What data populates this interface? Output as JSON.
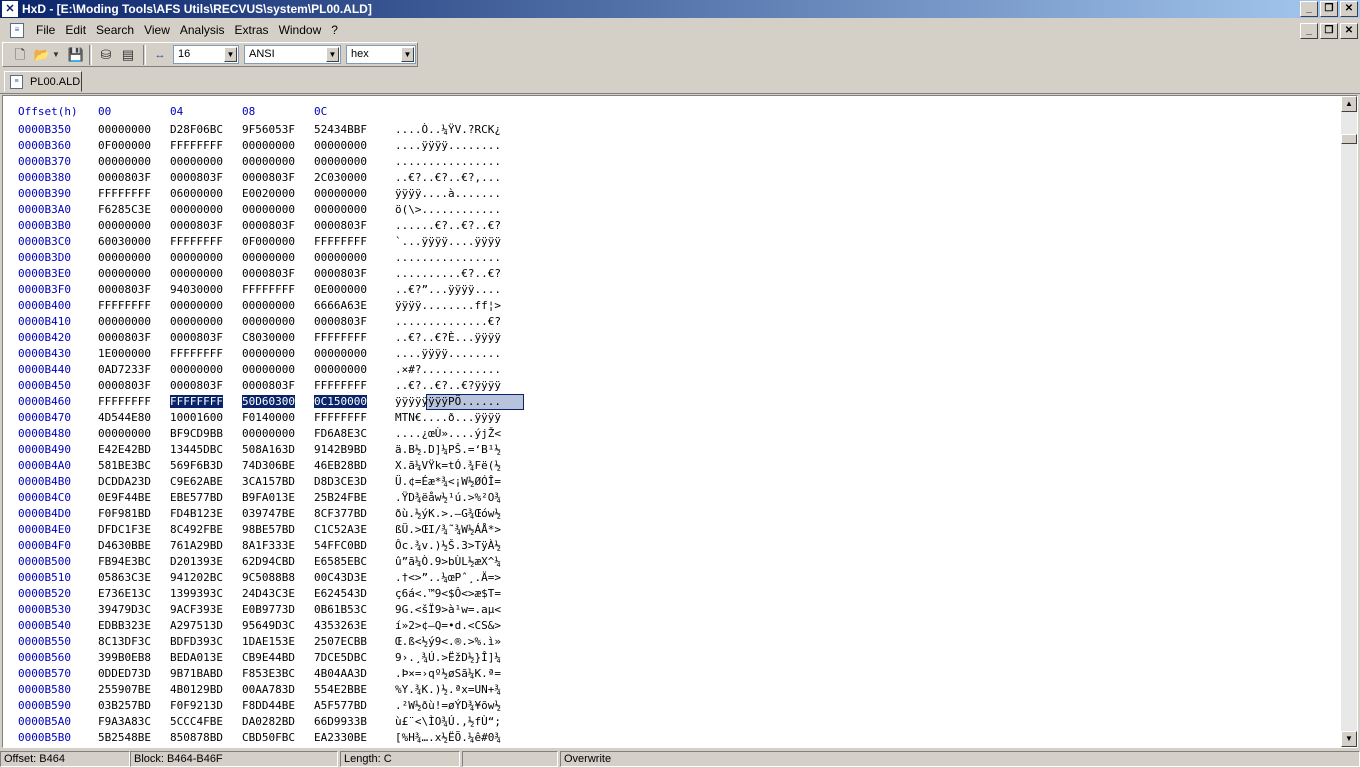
{
  "window": {
    "title": "HxD - [E:\\Moding Tools\\AFS Utils\\RECVUS\\system\\PL00.ALD]",
    "app_icon": "hxd-logo-icon"
  },
  "menu": [
    "File",
    "Edit",
    "Search",
    "View",
    "Analysis",
    "Extras",
    "Window",
    "?"
  ],
  "toolbar": {
    "bytes_per_row": "16",
    "charset": "ANSI",
    "offset_base": "hex"
  },
  "tab": {
    "label": "PL00.ALD"
  },
  "editor": {
    "header": {
      "offset": "Offset(h)",
      "cols": [
        "00",
        "04",
        "08",
        "0C"
      ]
    },
    "rows": [
      {
        "o": "0000B350",
        "g": [
          "00000000",
          "D28F06BC",
          "9F56053F",
          "52434BBF"
        ],
        "a": "....Ò..¼ŸV.?RCK¿"
      },
      {
        "o": "0000B360",
        "g": [
          "0F000000",
          "FFFFFFFF",
          "00000000",
          "00000000"
        ],
        "a": "....ÿÿÿÿ........"
      },
      {
        "o": "0000B370",
        "g": [
          "00000000",
          "00000000",
          "00000000",
          "00000000"
        ],
        "a": "................"
      },
      {
        "o": "0000B380",
        "g": [
          "0000803F",
          "0000803F",
          "0000803F",
          "2C030000"
        ],
        "a": "..€?..€?..€?,..."
      },
      {
        "o": "0000B390",
        "g": [
          "FFFFFFFF",
          "06000000",
          "E0020000",
          "00000000"
        ],
        "a": "ÿÿÿÿ....à......."
      },
      {
        "o": "0000B3A0",
        "g": [
          "F6285C3E",
          "00000000",
          "00000000",
          "00000000"
        ],
        "a": "ö(\\>............"
      },
      {
        "o": "0000B3B0",
        "g": [
          "00000000",
          "0000803F",
          "0000803F",
          "0000803F"
        ],
        "a": "......€?..€?..€?"
      },
      {
        "o": "0000B3C0",
        "g": [
          "60030000",
          "FFFFFFFF",
          "0F000000",
          "FFFFFFFF"
        ],
        "a": "`...ÿÿÿÿ....ÿÿÿÿ"
      },
      {
        "o": "0000B3D0",
        "g": [
          "00000000",
          "00000000",
          "00000000",
          "00000000"
        ],
        "a": "................"
      },
      {
        "o": "0000B3E0",
        "g": [
          "00000000",
          "00000000",
          "0000803F",
          "0000803F"
        ],
        "a": "..........€?..€?"
      },
      {
        "o": "0000B3F0",
        "g": [
          "0000803F",
          "94030000",
          "FFFFFFFF",
          "0E000000"
        ],
        "a": "..€?”...ÿÿÿÿ...."
      },
      {
        "o": "0000B400",
        "g": [
          "FFFFFFFF",
          "00000000",
          "00000000",
          "6666A63E"
        ],
        "a": "ÿÿÿÿ........ff¦>"
      },
      {
        "o": "0000B410",
        "g": [
          "00000000",
          "00000000",
          "00000000",
          "0000803F"
        ],
        "a": "..............€?"
      },
      {
        "o": "0000B420",
        "g": [
          "0000803F",
          "0000803F",
          "C8030000",
          "FFFFFFFF"
        ],
        "a": "..€?..€?È...ÿÿÿÿ"
      },
      {
        "o": "0000B430",
        "g": [
          "1E000000",
          "FFFFFFFF",
          "00000000",
          "00000000"
        ],
        "a": "....ÿÿÿÿ........"
      },
      {
        "o": "0000B440",
        "g": [
          "0AD7233F",
          "00000000",
          "00000000",
          "00000000"
        ],
        "a": ".×#?............"
      },
      {
        "o": "0000B450",
        "g": [
          "0000803F",
          "0000803F",
          "0000803F",
          "FFFFFFFF"
        ],
        "a": "..€?..€?..€?ÿÿÿÿ"
      },
      {
        "o": "0000B460",
        "g": [
          "FFFFFFFF",
          "FFFFFFFF",
          "50D60300",
          "0C150000"
        ],
        "a": "ÿÿÿÿÿÿÿÿPÖ......"
      },
      {
        "o": "0000B470",
        "g": [
          "4D544E80",
          "10001600",
          "F0140000",
          "FFFFFFFF"
        ],
        "a": "MTN€....ð...ÿÿÿÿ"
      },
      {
        "o": "0000B480",
        "g": [
          "00000000",
          "BF9CD9BB",
          "00000000",
          "FD6A8E3C"
        ],
        "a": "....¿œÙ»....ýjŽ<"
      },
      {
        "o": "0000B490",
        "g": [
          "E42E42BD",
          "13445DBC",
          "508A163D",
          "9142B9BD"
        ],
        "a": "ä.B½.D]¼PŠ.=‘B¹½"
      },
      {
        "o": "0000B4A0",
        "g": [
          "581BE3BC",
          "569F6B3D",
          "74D306BE",
          "46EB28BD"
        ],
        "a": "X.ã¼VŸk=tÓ.¾Fë(½"
      },
      {
        "o": "0000B4B0",
        "g": [
          "DCDDA23D",
          "C9E62ABE",
          "3CA157BD",
          "D8D3CE3D"
        ],
        "a": "Ü.¢=Éæ*¾<¡W½ØÓÎ="
      },
      {
        "o": "0000B4C0",
        "g": [
          "0E9F44BE",
          "EBE577BD",
          "B9FA013E",
          "25B24FBE"
        ],
        "a": ".ŸD¾ëåw½¹ú.>%²O¾"
      },
      {
        "o": "0000B4D0",
        "g": [
          "F0F981BD",
          "FD4B123E",
          "039747BE",
          "8CF377BD"
        ],
        "a": "ðù.½ýK.>.—G¾Œów½"
      },
      {
        "o": "0000B4E0",
        "g": [
          "DFDC1F3E",
          "8C492FBE",
          "98BE57BD",
          "C1C52A3E"
        ],
        "a": "ßÜ.>ŒI/¾˜¾W½ÁÅ*>"
      },
      {
        "o": "0000B4F0",
        "g": [
          "D4630BBE",
          "761A29BD",
          "8A1F333E",
          "54FFC0BD"
        ],
        "a": "Ôc.¾v.)½Š.3>TÿÀ½"
      },
      {
        "o": "0000B500",
        "g": [
          "FB94E3BC",
          "D201393E",
          "62D94CBD",
          "E6585EBC"
        ],
        "a": "û”ã¼Ò.9>bÙL½æX^¼"
      },
      {
        "o": "0000B510",
        "g": [
          "05863C3E",
          "941202BC",
          "9C5088B8",
          "00C43D3E"
        ],
        "a": ".†<>”..¼œPˆ¸.Ä=>"
      },
      {
        "o": "0000B520",
        "g": [
          "E736E13C",
          "1399393C",
          "24D43C3E",
          "E624543D"
        ],
        "a": "ç6á<.™9<$Ô<>æ$T="
      },
      {
        "o": "0000B530",
        "g": [
          "39479D3C",
          "9ACF393E",
          "E0B9773D",
          "0B61B53C"
        ],
        "a": "9G.<šÏ9>à¹w=.aµ<"
      },
      {
        "o": "0000B540",
        "g": [
          "EDBB323E",
          "A297513D",
          "95649D3C",
          "4353263E"
        ],
        "a": "í»2>¢—Q=•d.<CS&>"
      },
      {
        "o": "0000B550",
        "g": [
          "8C13DF3C",
          "BDFD393C",
          "1DAE153E",
          "2507ECBB"
        ],
        "a": "Œ.ß<½ý9<.®.>%.ì»"
      },
      {
        "o": "0000B560",
        "g": [
          "399B0EB8",
          "BEDA013E",
          "CB9E44BD",
          "7DCE5DBC"
        ],
        "a": "9›.¸¾Ú.>ËžD½}Î]¼"
      },
      {
        "o": "0000B570",
        "g": [
          "0DDED73D",
          "9B71BABD",
          "F853E3BC",
          "4B04AA3D"
        ],
        "a": ".Þ×=›qº½øSã¼K.ª="
      },
      {
        "o": "0000B580",
        "g": [
          "255907BE",
          "4B0129BD",
          "00AA783D",
          "554E2BBE"
        ],
        "a": "%Y.¾K.)½.ªx=UN+¾"
      },
      {
        "o": "0000B590",
        "g": [
          "03B257BD",
          "F0F9213D",
          "F8DD44BE",
          "A5F577BD"
        ],
        "a": ".²W½ðù!=øÝD¾¥õw½"
      },
      {
        "o": "0000B5A0",
        "g": [
          "F9A3A83C",
          "5CCC4FBE",
          "DA0282BD",
          "66D9933B"
        ],
        "a": "ù£¨<\\ÌO¾Ú.‚½fÙ“;"
      },
      {
        "o": "0000B5B0",
        "g": [
          "5B2548BE",
          "850878BD",
          "CBD50FBC",
          "EA2330BE"
        ],
        "a": "[%H¾….x½ËÕ.¼ê#0¾"
      }
    ]
  },
  "status": {
    "offset": "Offset: B464",
    "block": "Block: B464-B46F",
    "length": "Length: C",
    "mode": "Overwrite"
  }
}
